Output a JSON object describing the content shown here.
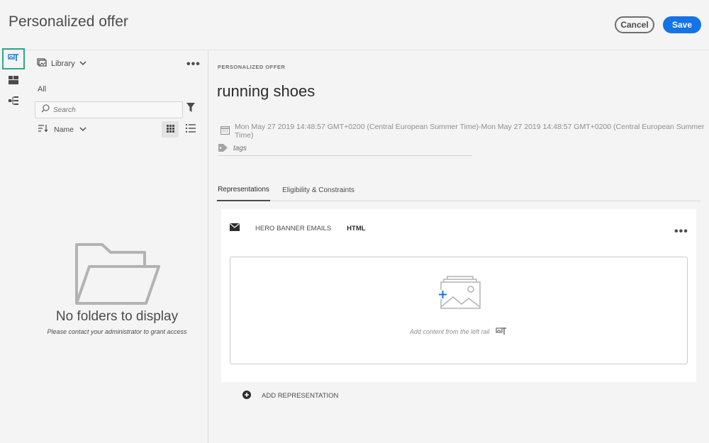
{
  "header": {
    "title": "Personalized offer",
    "cancel_label": "Cancel",
    "save_label": "Save"
  },
  "rail": {
    "items": [
      {
        "icon": "image-text-icon",
        "active": true
      },
      {
        "icon": "layout-blocks-icon",
        "active": false
      },
      {
        "icon": "structure-tree-icon",
        "active": false
      }
    ]
  },
  "library": {
    "source_label": "Library",
    "folder_label": "All",
    "search_placeholder": "Search",
    "sort_label": "Name",
    "empty_title": "No folders to display",
    "empty_subtitle": "Please contact your administrator to grant access"
  },
  "offer": {
    "kicker": "PERSONALIZED OFFER",
    "name": "running shoes",
    "date_range": "Mon May 27 2019 14:48:57 GMT+0200 (Central European Summer Time)-Mon May 27 2019 14:48:57 GMT+0200 (Central European Summer Time)",
    "tags_placeholder": "tags"
  },
  "tabs": [
    {
      "label": "Representations",
      "selected": true
    },
    {
      "label": "Eligibility & Constraints",
      "selected": false
    }
  ],
  "representation": {
    "channel_icon": "envelope-icon",
    "placement": "HERO BANNER EMAILS",
    "format": "HTML",
    "dropzone_text": "Add content from the left rail"
  },
  "add_representation_label": "ADD REPRESENTATION",
  "colors": {
    "accent": "#1473e6",
    "rail_active": "#2ea98c",
    "background": "#f4f4f4"
  }
}
